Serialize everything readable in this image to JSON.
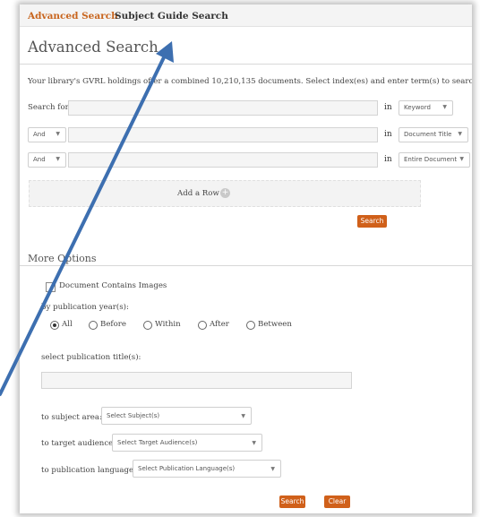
{
  "nav": {
    "tab_advanced": "Advanced Search",
    "tab_subject": "Subject Guide Search"
  },
  "page_title": "Advanced Search",
  "intro": "Your library's GVRL holdings offer a combined  10,210,135 documents. Select index(es) and enter term(s) to search.",
  "rows": [
    {
      "label": "Search for",
      "in": "in",
      "index": "Keyword"
    },
    {
      "operator": "And",
      "in": "in",
      "index": "Document Title"
    },
    {
      "operator": "And",
      "in": "in",
      "index": "Entire Document"
    }
  ],
  "add_row": "Add a Row",
  "search_button": "Search",
  "more_options": "More Options",
  "contains_images": "Document Contains Images",
  "pub_year_label": "by publication year(s):",
  "year_options": [
    "All",
    "Before",
    "Within",
    "After",
    "Between"
  ],
  "pub_title_label": "select publication title(s):",
  "subject_label": "to subject area:",
  "subject_select": "Select Subject(s)",
  "audience_label": "to target audience",
  "audience_select": "Select Target Audience(s)",
  "language_label": "to publication language:",
  "language_select": "Select Publication Language(s)",
  "bottom_search": "Search",
  "clear_button": "Clear",
  "colors": {
    "accent": "#d0601a",
    "arrow": "#3d6fb0"
  }
}
